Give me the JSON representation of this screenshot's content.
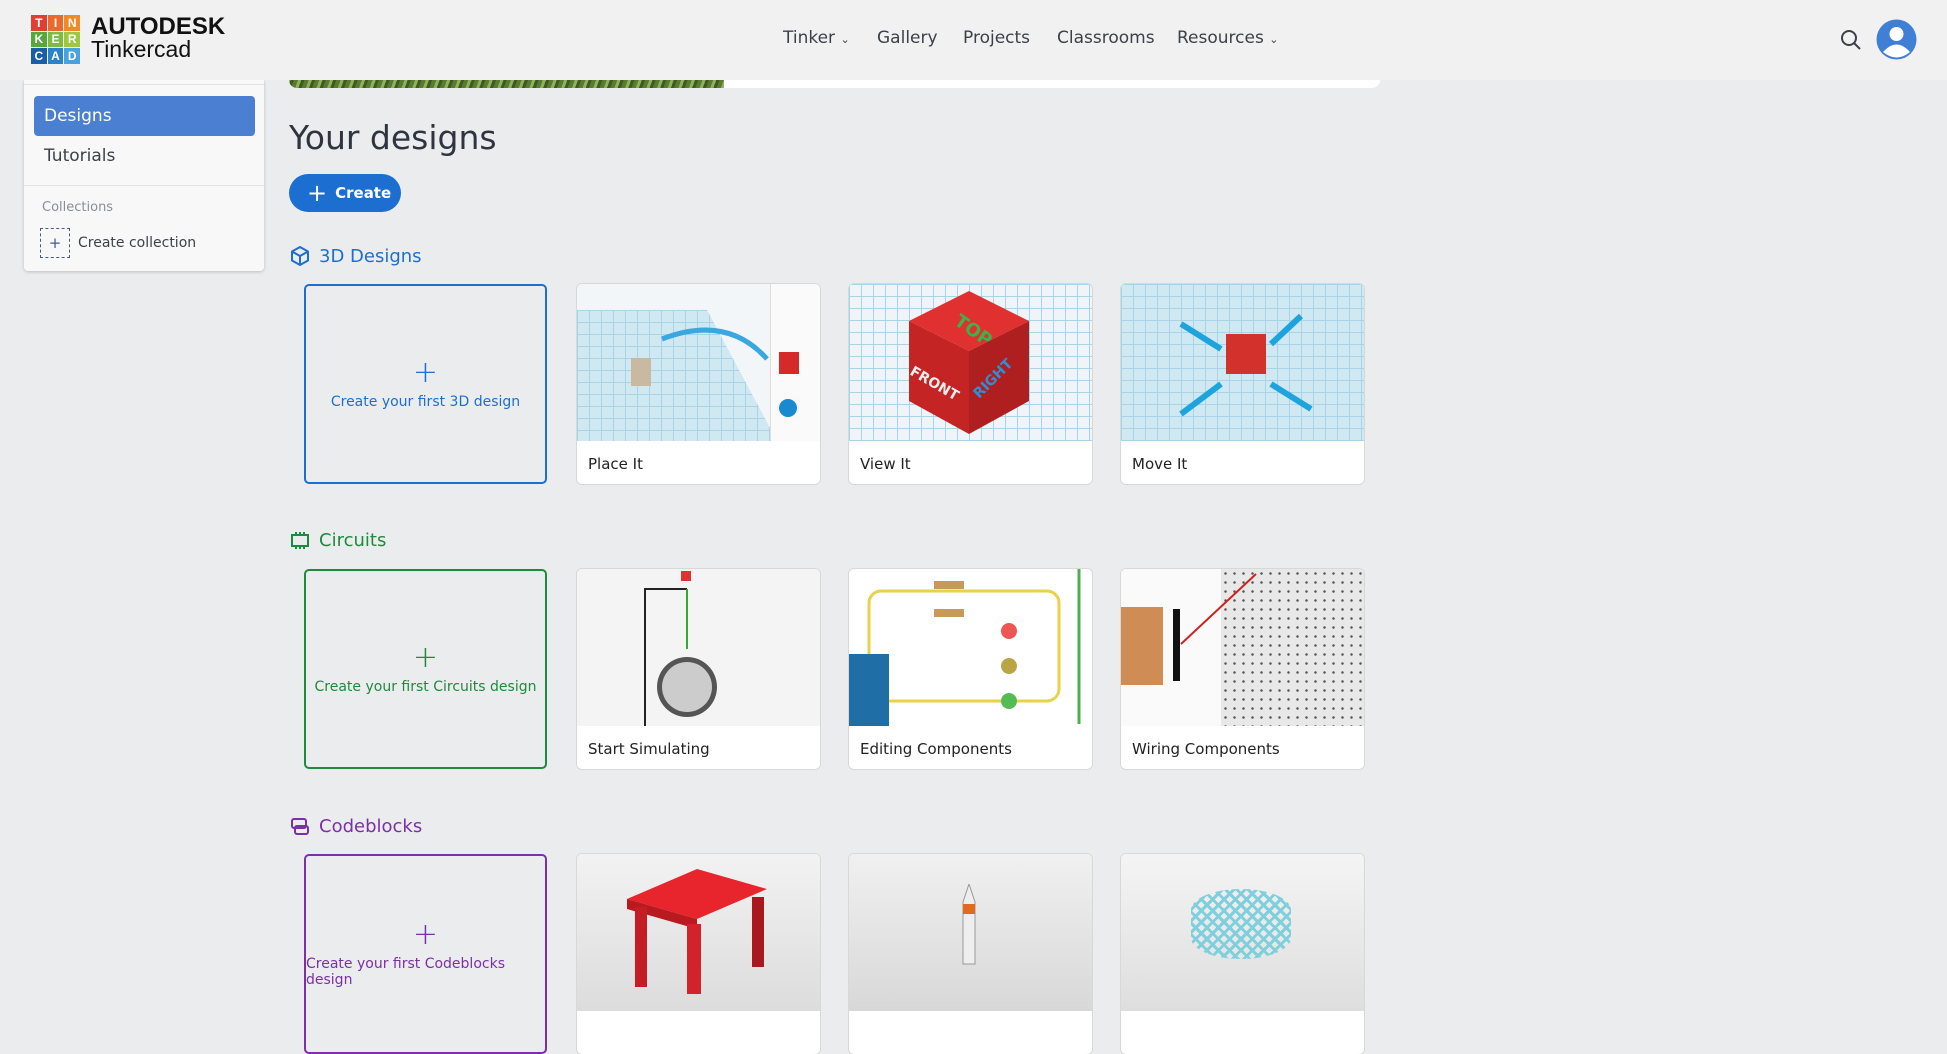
{
  "header": {
    "logo_letters": [
      "T",
      "I",
      "N",
      "K",
      "E",
      "R",
      "C",
      "A",
      "D"
    ],
    "brand_top": "AUTODESK",
    "brand_bottom": "Tinkercad",
    "nav": [
      {
        "label": "Tinker",
        "dropdown": true
      },
      {
        "label": "Gallery"
      },
      {
        "label": "Projects"
      },
      {
        "label": "Classrooms"
      },
      {
        "label": "Resources",
        "dropdown": true
      }
    ],
    "search_icon": "search-icon",
    "avatar_icon": "user-avatar-icon"
  },
  "sidebar": {
    "items": [
      {
        "label": "Designs",
        "active": true
      },
      {
        "label": "Tutorials"
      }
    ],
    "collections_label": "Collections",
    "create_collection": "Create collection"
  },
  "main": {
    "title": "Your designs",
    "create_label": "Create",
    "sections": [
      {
        "title": "3D Designs",
        "color": "#1c6fd0",
        "new_label": "Create your first 3D design",
        "cards": [
          "Place It",
          "View It",
          "Move It"
        ]
      },
      {
        "title": "Circuits",
        "color": "#1e8a3c",
        "new_label": "Create your first Circuits design",
        "cards": [
          "Start Simulating",
          "Editing Components",
          "Wiring Components"
        ]
      },
      {
        "title": "Codeblocks",
        "color": "#7b2fa8",
        "new_label": "Create your first Codeblocks design",
        "cards": [
          "",
          "",
          ""
        ]
      }
    ]
  }
}
